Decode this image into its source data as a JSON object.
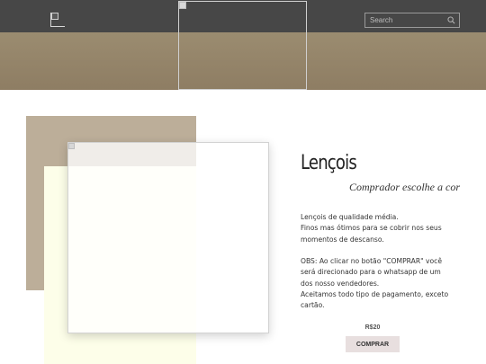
{
  "header": {
    "search": {
      "placeholder": "Search",
      "icon": "search-icon"
    },
    "colors": {
      "topbar": "#474747",
      "band": "#8e7d63"
    }
  },
  "product": {
    "title": "Lençois",
    "subtitle": "Comprador escolhe a cor",
    "description_lines": [
      "Lençois de qualidade média.",
      "Finos mas ótimos para se cobrir nos seus",
      "momentos de descanso.",
      "",
      "OBS: Ao clicar no botão \"COMPRAR\" você",
      "será direcionado para o whatsapp de um",
      "dos nosso vendedores.",
      "Aceitamos todo tipo de pagamento, exceto",
      "cartão."
    ],
    "price": "R$20",
    "buy_label": "COMPRAR",
    "colors": {
      "tan": "#bcae99",
      "cream": "#fdfee9",
      "button": "#e8dfdf"
    }
  }
}
